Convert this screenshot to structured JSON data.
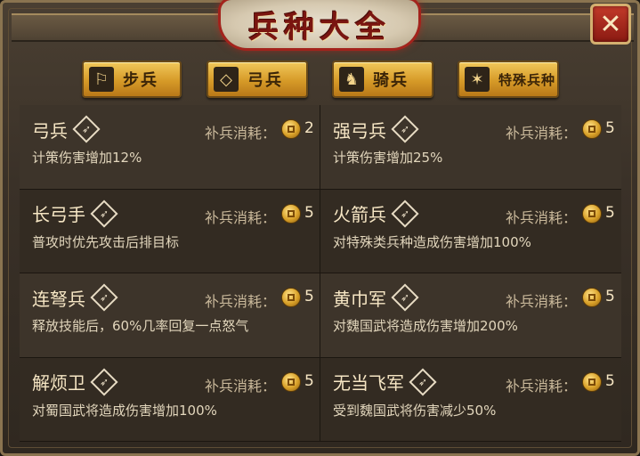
{
  "window": {
    "title": "兵种大全",
    "close_glyph": "✕"
  },
  "tabs": [
    {
      "label": "步兵",
      "icon": "boot-icon",
      "glyph": "⚐"
    },
    {
      "label": "弓兵",
      "icon": "bow-icon",
      "glyph": "◇"
    },
    {
      "label": "骑兵",
      "icon": "horse-icon",
      "glyph": "♞"
    },
    {
      "label": "特殊兵种",
      "icon": "star-icon",
      "glyph": "✶"
    }
  ],
  "cost_label": "补兵消耗：",
  "units": [
    {
      "name": "弓兵",
      "cost": "2",
      "desc": "计策伤害增加12%"
    },
    {
      "name": "强弓兵",
      "cost": "5",
      "desc": "计策伤害增加25%"
    },
    {
      "name": "长弓手",
      "cost": "5",
      "desc": "普攻时优先攻击后排目标"
    },
    {
      "name": "火箭兵",
      "cost": "5",
      "desc": "对特殊类兵种造成伤害增加100%"
    },
    {
      "name": "连弩兵",
      "cost": "5",
      "desc": "释放技能后，60%几率回复一点怒气"
    },
    {
      "name": "黄巾军",
      "cost": "5",
      "desc": "对魏国武将造成伤害增加200%"
    },
    {
      "name": "解烦卫",
      "cost": "5",
      "desc": "对蜀国武将造成伤害增加100%"
    },
    {
      "name": "无当飞军",
      "cost": "5",
      "desc": "受到魏国武将伤害减少50%"
    }
  ],
  "colors": {
    "accent_gold": "#d69a28",
    "title_red": "#a3231c",
    "text_light": "#f6e6c4"
  }
}
